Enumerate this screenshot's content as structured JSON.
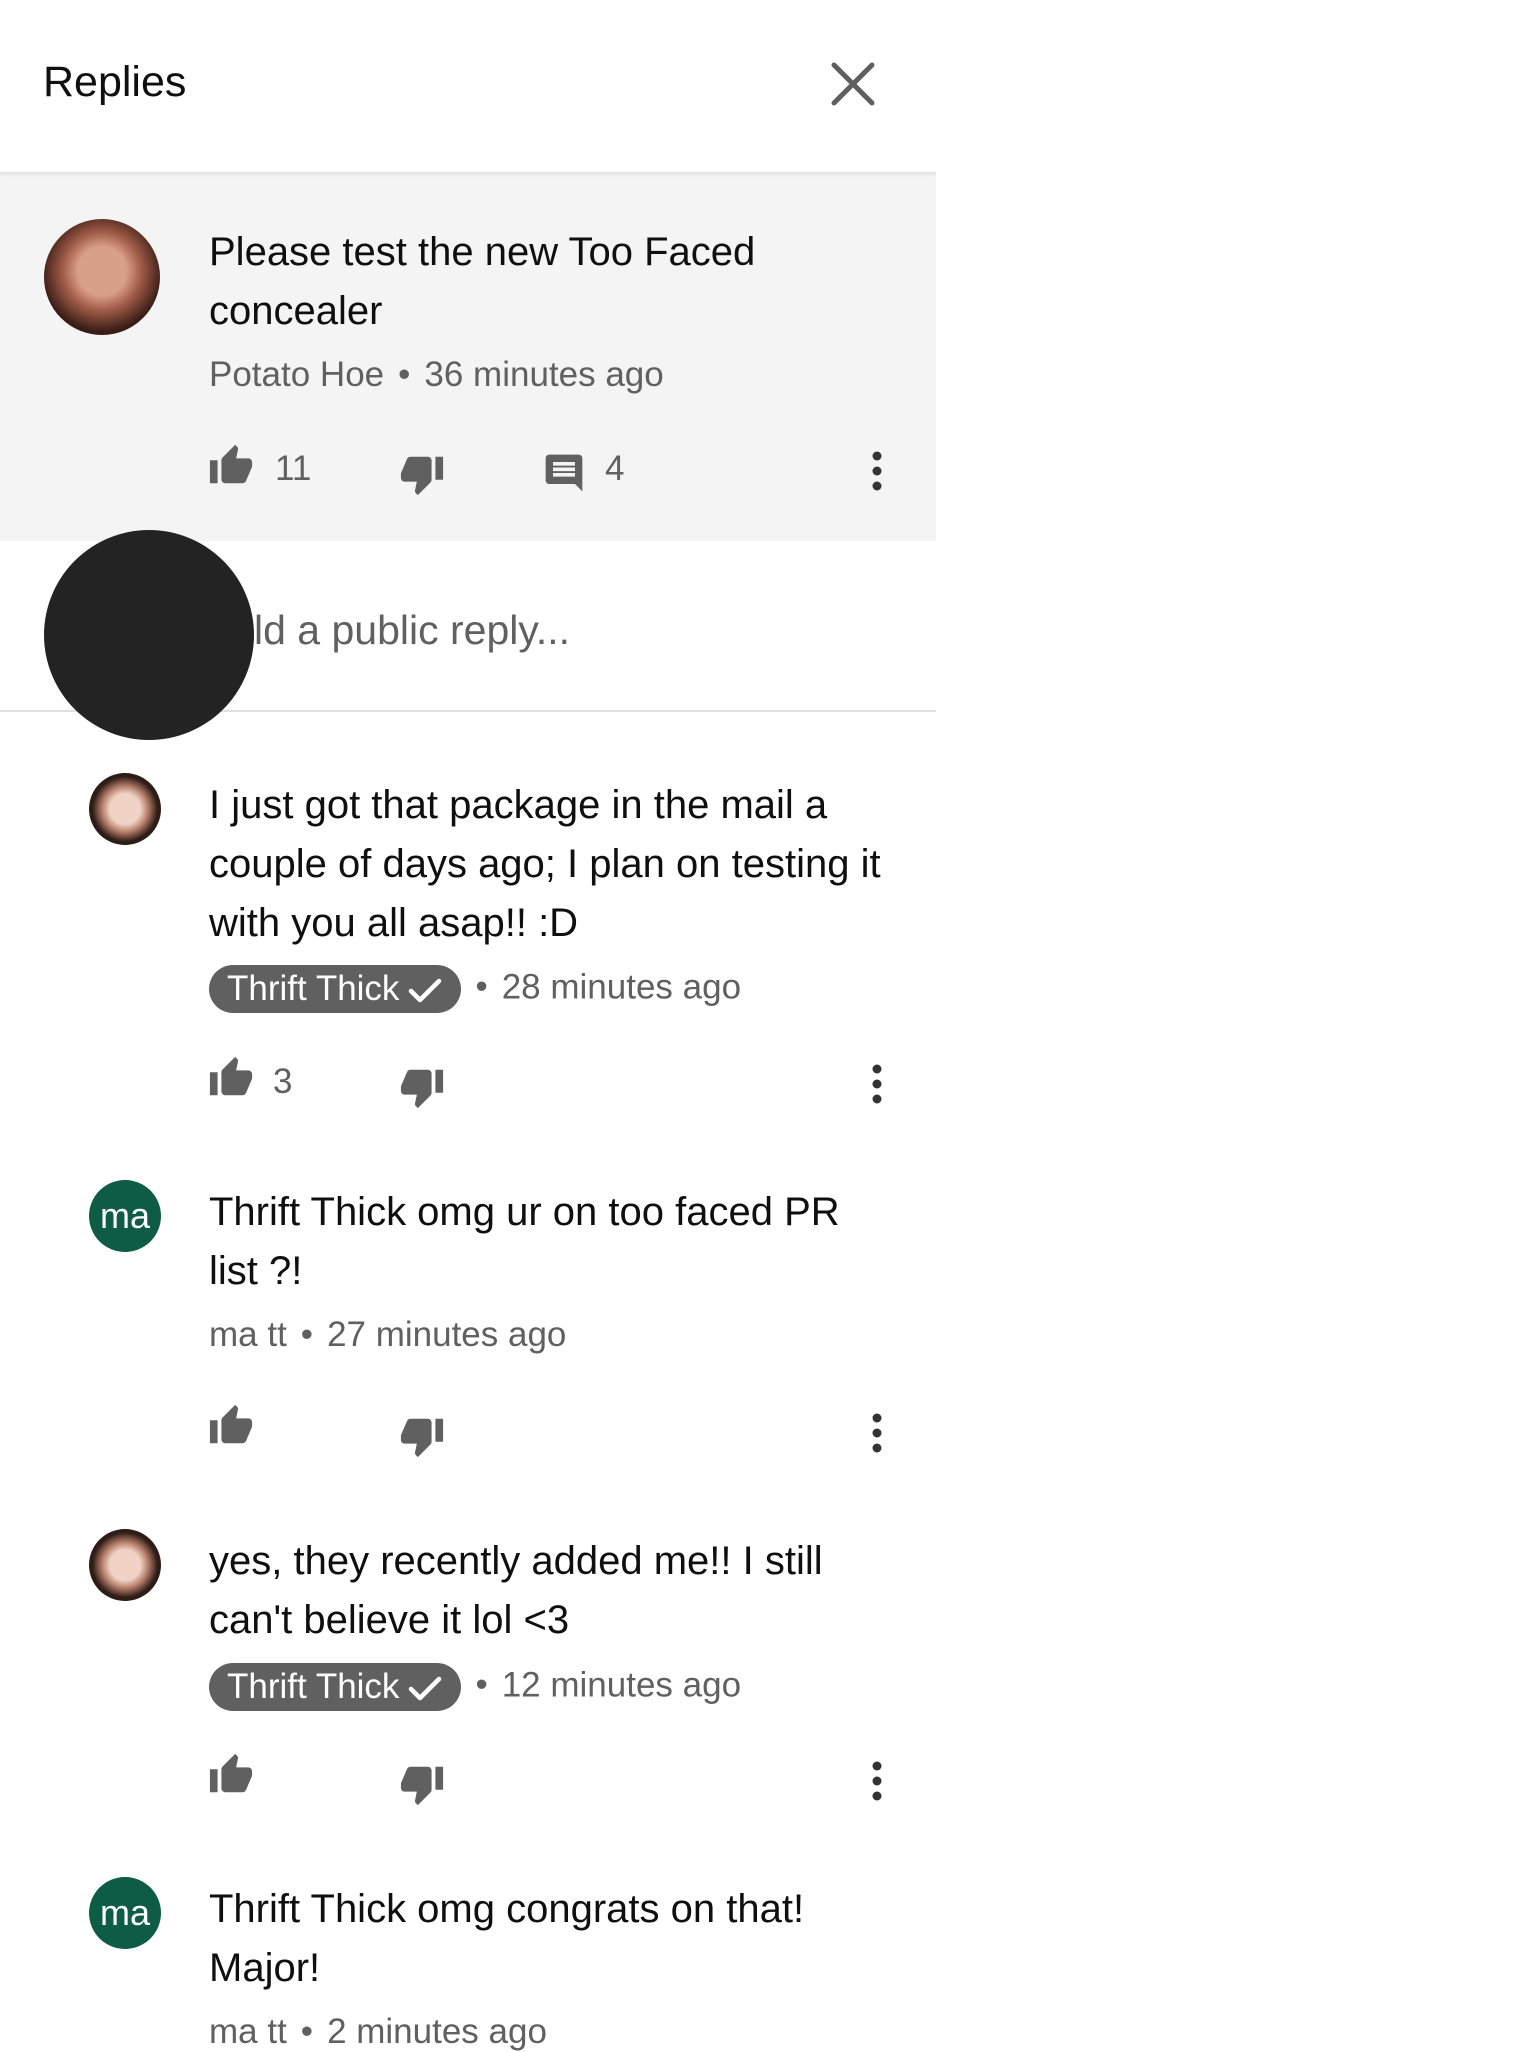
{
  "header": {
    "title": "Replies"
  },
  "parent": {
    "text": "Please test the new Too Faced concealer",
    "author": "Potato Hoe",
    "time": "36 minutes ago",
    "likes": "11",
    "replies": "4"
  },
  "reply_box": {
    "placeholder": "Add a public reply...",
    "visible_text": "ld a public reply..."
  },
  "comments": [
    {
      "text": "I just got that package in the mail a couple of days ago; I plan on testing it with you all asap!! :D",
      "author": "Thrift Thick",
      "time": "28 minutes ago",
      "likes": "3",
      "verified": true,
      "avatar": "photo"
    },
    {
      "text": "Thrift Thick omg ur on too faced PR list ?!",
      "author": "ma tt",
      "time": "27 minutes ago",
      "likes": "",
      "verified": false,
      "avatar": "ma"
    },
    {
      "text": "yes, they recently added me!! I still can't believe it lol <3",
      "author": "Thrift Thick",
      "time": "12 minutes ago",
      "likes": "",
      "verified": true,
      "avatar": "photo"
    },
    {
      "text": "Thrift Thick omg congrats on that! Major!",
      "author": "ma tt",
      "time": "2 minutes ago",
      "likes": "",
      "verified": false,
      "avatar": "ma"
    }
  ],
  "colors": {
    "panel_bg": "#f4f4f4",
    "badge_bg": "#606060",
    "avatar_ma": "#0d5c43",
    "meta_text": "#606060"
  },
  "icons": [
    "close-icon",
    "thumbs-up-icon",
    "thumbs-down-icon",
    "comment-icon",
    "more-vert-icon",
    "checkmark-icon"
  ]
}
